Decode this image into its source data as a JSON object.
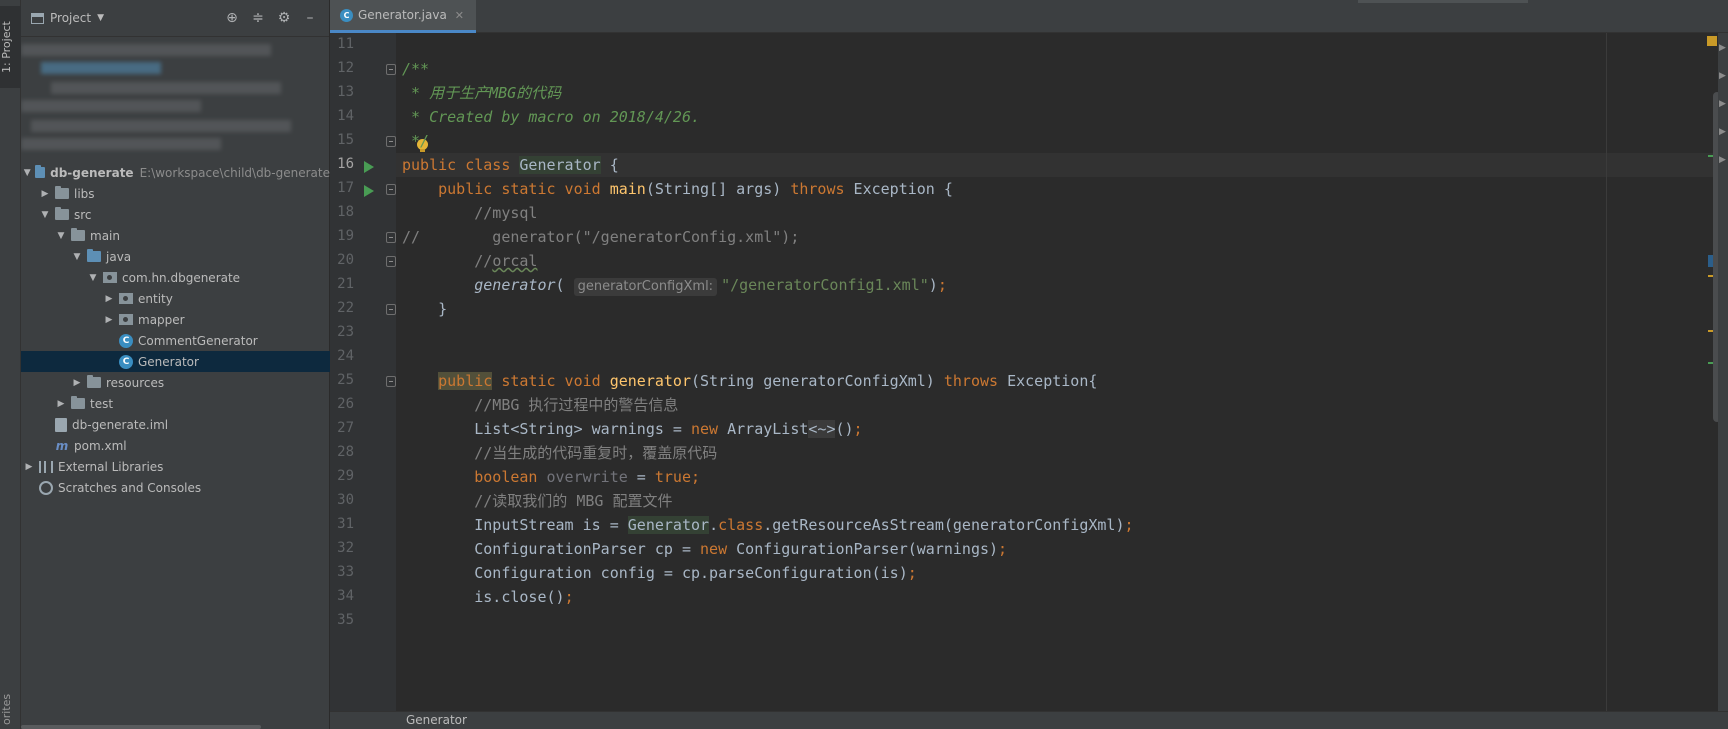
{
  "tool_stripe": {
    "project_tab": "1: Project",
    "favorites_tab": "orites"
  },
  "project_panel": {
    "title": "Project",
    "tree": [
      {
        "label": "db-generate",
        "hint": "E:\\workspace\\child\\db-generate",
        "kind": "module"
      },
      {
        "label": "libs",
        "kind": "folder"
      },
      {
        "label": "src",
        "kind": "folder"
      },
      {
        "label": "main",
        "kind": "folder"
      },
      {
        "label": "java",
        "kind": "folder"
      },
      {
        "label": "com.hn.dbgenerate",
        "kind": "package"
      },
      {
        "label": "entity",
        "kind": "package"
      },
      {
        "label": "mapper",
        "kind": "package"
      },
      {
        "label": "CommentGenerator",
        "kind": "class"
      },
      {
        "label": "Generator",
        "kind": "class",
        "selected": true
      },
      {
        "label": "resources",
        "kind": "folder"
      },
      {
        "label": "test",
        "kind": "folder"
      },
      {
        "label": "db-generate.iml",
        "kind": "file"
      },
      {
        "label": "pom.xml",
        "kind": "file"
      },
      {
        "label": "External Libraries",
        "kind": "libraries"
      },
      {
        "label": "Scratches and Consoles",
        "kind": "scratches"
      }
    ]
  },
  "editor": {
    "tab_label": "Generator.java",
    "breadcrumb": "Generator",
    "line_numbers": [
      "11",
      "12",
      "13",
      "14",
      "15",
      "16",
      "17",
      "18",
      "19",
      "20",
      "21",
      "22",
      "23",
      "24",
      "25",
      "26",
      "27",
      "28",
      "29",
      "30",
      "31",
      "32",
      "33",
      "34",
      "35"
    ],
    "code": {
      "l12": "/**",
      "l13": " * 用于生产MBG的代码",
      "l14": " * Created by macro on 2018/4/26.",
      "l15": " */",
      "l16_kw": "public class ",
      "l16_name": "Generator",
      "l16_rest": " {",
      "l17_kw": "    public static void ",
      "l17_fn": "main",
      "l17_mid": "(String[] args) ",
      "l17_throws": "throws",
      "l17_rest": " Exception {",
      "l18": "        //mysql",
      "l19": "//        generator(\"/generatorConfig.xml\");",
      "l20_a": "        //",
      "l20_b": "orcal",
      "l21_indent": "        ",
      "l21_fn": "generator",
      "l21_open": "(",
      "l21_hint": "generatorConfigXml:",
      "l21_str": "\"/generatorConfig1.xml\"",
      "l21_close": ")",
      "l21_semi": ";",
      "l22": "    }",
      "l25_indent": "    ",
      "l25_pub": "public",
      "l25_kw": " static void ",
      "l25_fn": "generator",
      "l25_mid": "(String generatorConfigXml) ",
      "l25_throws": "throws",
      "l25_rest": " Exception{",
      "l26": "        //MBG 执行过程中的警告信息",
      "l27_a": "        List<String> warnings = ",
      "l27_new": "new",
      "l27_b": " ArrayList",
      "l27_diamond": "<~>",
      "l27_c": "()",
      "l27_semi": ";",
      "l28": "        //当生成的代码重复时，覆盖原代码",
      "l29_indent": "        ",
      "l29_kw": "boolean",
      "l29_var": " overwrite",
      "l29_eq": " = ",
      "l29_true": "true",
      "l29_semi": ";",
      "l30": "        //读取我们的 MBG 配置文件",
      "l31_a": "        InputStream is = ",
      "l31_gen": "Generator",
      "l31_dot": ".",
      "l31_class": "class",
      "l31_b": ".getResourceAsStream(generatorConfigXml)",
      "l31_semi": ";",
      "l32_a": "        ConfigurationParser cp = ",
      "l32_new": "new",
      "l32_b": " ConfigurationParser(warnings)",
      "l32_semi": ";",
      "l33_a": "        Configuration config = cp.parseConfiguration(is)",
      "l33_semi": ";",
      "l34_a": "        is.close()",
      "l34_semi": ";"
    }
  },
  "colors": {
    "keyword": "#cc7832",
    "comment": "#808080",
    "doc_comment": "#629755",
    "method": "#ffc66d",
    "string": "#6a8759",
    "selection": "#0d293e",
    "accent": "#4a88c7"
  }
}
